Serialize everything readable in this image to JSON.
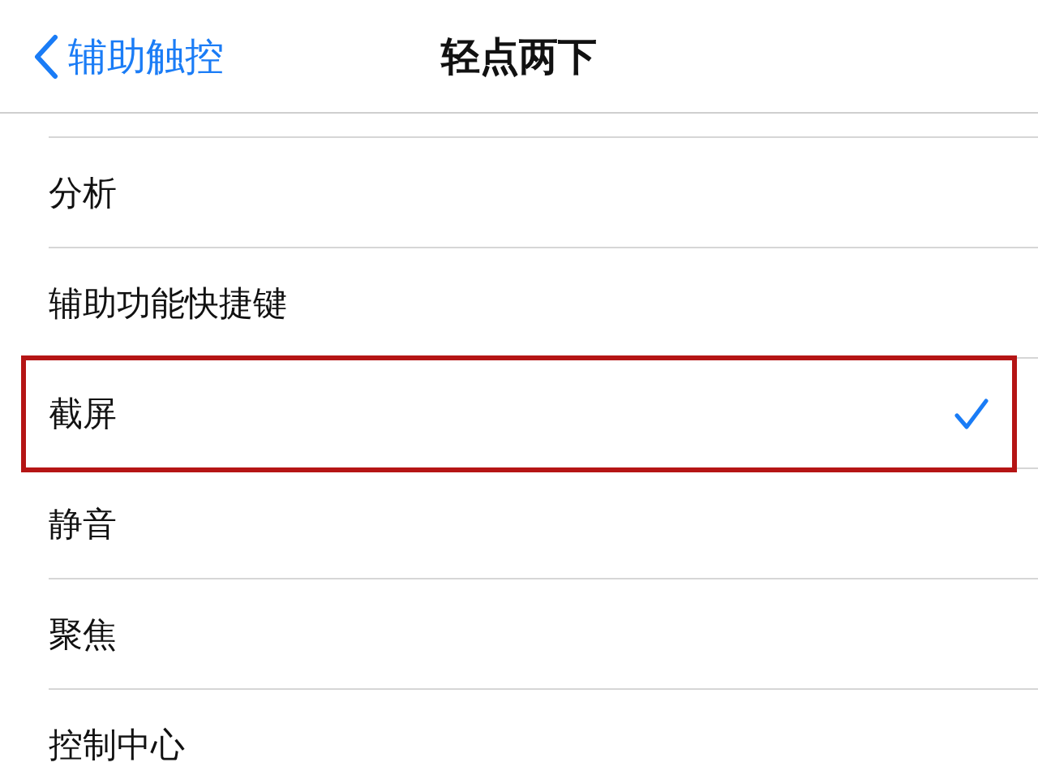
{
  "nav": {
    "back": "辅助触控",
    "title": "轻点两下"
  },
  "options": [
    {
      "label": "分析",
      "selected": false,
      "highlighted": false
    },
    {
      "label": "辅助功能快捷键",
      "selected": false,
      "highlighted": false
    },
    {
      "label": "截屏",
      "selected": true,
      "highlighted": true
    },
    {
      "label": "静音",
      "selected": false,
      "highlighted": false
    },
    {
      "label": "聚焦",
      "selected": false,
      "highlighted": false
    },
    {
      "label": "控制中心",
      "selected": false,
      "highlighted": false
    }
  ]
}
